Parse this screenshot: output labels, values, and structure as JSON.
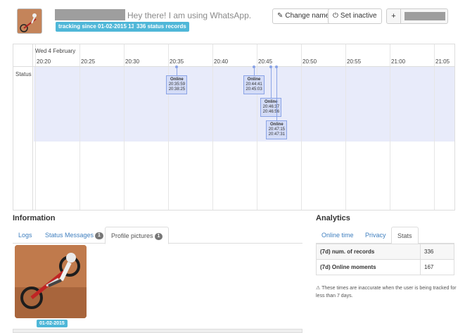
{
  "header": {
    "status_message": "Hey there! I am using WhatsApp.",
    "tracking_badge": "tracking since 01-02-2015 13:33:14",
    "records_badge": "336 status records",
    "change_name_label": "Change name",
    "set_inactive_label": "Set inactive",
    "add_label": "+"
  },
  "timeline": {
    "date_label": "Wed 4 February",
    "row_label": "Status",
    "ticks": [
      "20:20",
      "20:25",
      "20:30",
      "20:35",
      "20:40",
      "20:45",
      "20:50",
      "20:55",
      "21:00",
      "21:05"
    ],
    "events": [
      {
        "status": "Online",
        "start": "20:35:59",
        "end": "20:38:25"
      },
      {
        "status": "Online",
        "start": "20:44:41",
        "end": "20:45:03"
      },
      {
        "status": "Online",
        "start": "20:46:37",
        "end": "20:46:56"
      },
      {
        "status": "Online",
        "start": "20:47:15",
        "end": "20:47:31"
      }
    ]
  },
  "information": {
    "title": "Information",
    "tabs": [
      {
        "label": "Logs"
      },
      {
        "label": "Status Messages",
        "count": "1"
      },
      {
        "label": "Profile pictures",
        "count": "1"
      }
    ],
    "picture_date": "01-02-2015"
  },
  "analytics": {
    "title": "Analytics",
    "tabs": [
      {
        "label": "Online time"
      },
      {
        "label": "Privacy"
      },
      {
        "label": "Stats"
      }
    ],
    "rows": [
      {
        "key": "(7d) num. of records",
        "value": "336"
      },
      {
        "key": "(7d) Online moments",
        "value": "167"
      }
    ],
    "note": "These times are inaccurate when the user is being tracked for less than 7 days."
  },
  "colors": {
    "accent": "#4fb7d8",
    "band": "#e8ebfa",
    "event": "#8aa3e6",
    "link": "#3f7fbf"
  }
}
